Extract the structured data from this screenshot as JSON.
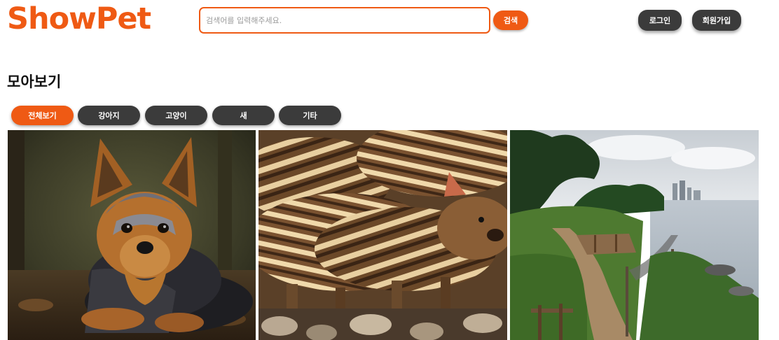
{
  "header": {
    "logo_text": "ShowPet",
    "search": {
      "placeholder": "검색어를 입력해주세요.",
      "value": ""
    },
    "search_button_label": "검색",
    "login_label": "로그인",
    "signup_label": "회원가입"
  },
  "main": {
    "title": "모아보기",
    "tabs": [
      {
        "label": "전체보기",
        "active": true
      },
      {
        "label": "강아지",
        "active": false
      },
      {
        "label": "고양이",
        "active": false
      },
      {
        "label": "새",
        "active": false
      },
      {
        "label": "기타",
        "active": false
      }
    ],
    "gallery": [
      {
        "subject": "yorkshire-terrier-dog"
      },
      {
        "subject": "striped-wild-boar-piglets"
      },
      {
        "subject": "coastal-boardwalk-path"
      }
    ]
  },
  "colors": {
    "accent": "#ef5a14",
    "dark_button": "#3b3b3b",
    "background": "#ffffff"
  }
}
